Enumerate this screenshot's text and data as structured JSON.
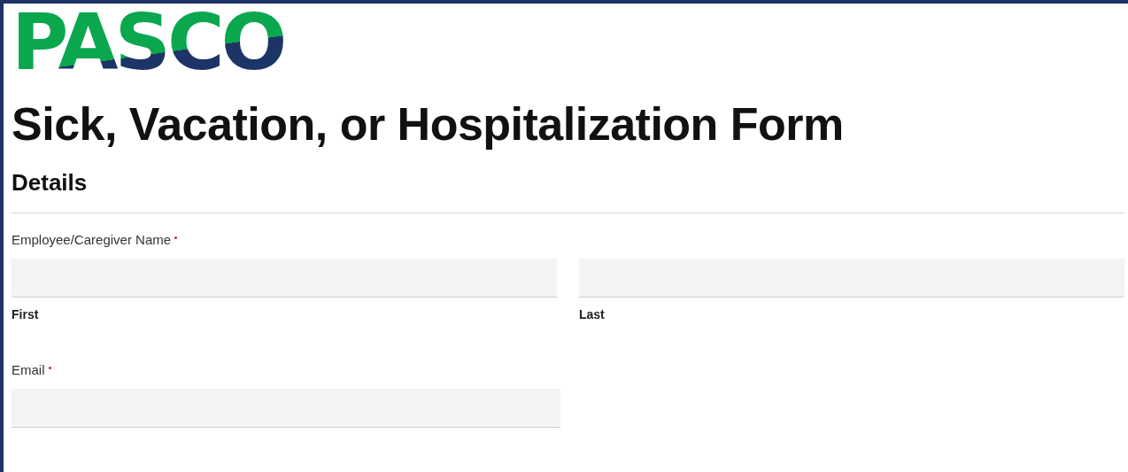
{
  "logo": {
    "text": "PASCO"
  },
  "title": "Sick, Vacation, or Hospitalization Form",
  "section": {
    "heading": "Details"
  },
  "fields": [
    {
      "kind": "name",
      "label": "Employee/Caregiver Name",
      "required": true,
      "parts": [
        {
          "sublabel": "First"
        },
        {
          "sublabel": "Last"
        }
      ]
    },
    {
      "kind": "single",
      "label": "Email",
      "required": true
    }
  ]
}
